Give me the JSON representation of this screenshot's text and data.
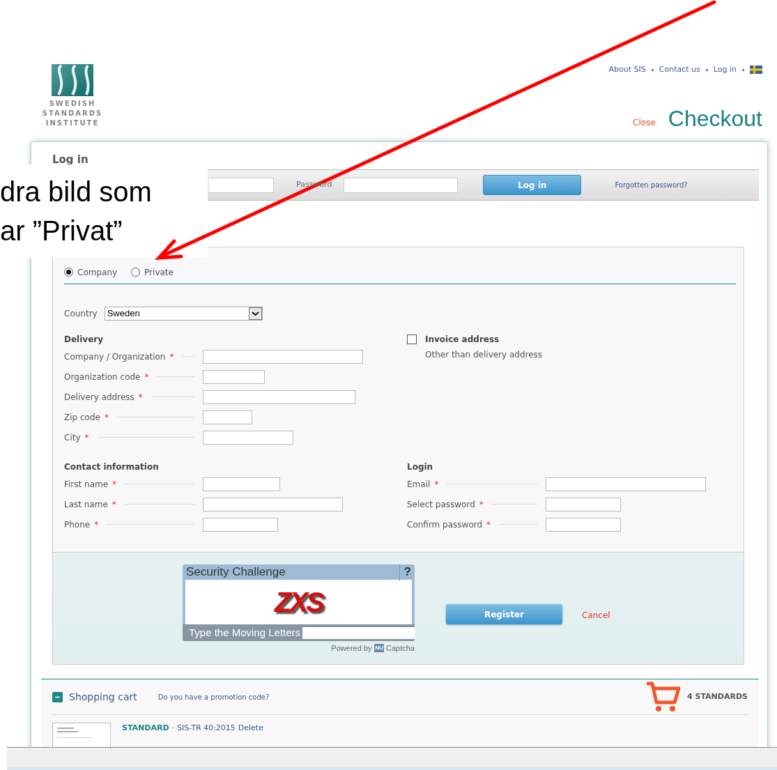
{
  "top_links": [
    "About SIS",
    "Contact us",
    "Log in"
  ],
  "logo": {
    "lines": [
      "SWEDISH",
      "STANDARDS",
      "INSTITUTE"
    ]
  },
  "close": "Close",
  "title": "Checkout",
  "login": {
    "heading": "Log in",
    "password_label": "Password",
    "button": "Log in",
    "forgot": "Forgotten password?"
  },
  "annotation": {
    "lines": [
      "dra bild som",
      "ar ”Privat”"
    ]
  },
  "customer_types": [
    {
      "label": "Company",
      "selected": true
    },
    {
      "label": "Private",
      "selected": false
    }
  ],
  "country": {
    "label": "Country",
    "value": "Sweden"
  },
  "required_mark": "*",
  "delivery": {
    "heading": "Delivery",
    "fields": [
      {
        "label": "Company / Organization",
        "required": true
      },
      {
        "label": "Organization code",
        "required": true
      },
      {
        "label": "Delivery address",
        "required": true
      },
      {
        "label": "Zip code",
        "required": true
      },
      {
        "label": "City",
        "required": true
      }
    ]
  },
  "invoice": {
    "label": "Invoice address",
    "checked": false,
    "note": "Other than delivery address"
  },
  "contact": {
    "heading": "Contact information",
    "fields": [
      {
        "label": "First name",
        "required": true
      },
      {
        "label": "Last name",
        "required": true
      },
      {
        "label": "Phone",
        "required": true
      }
    ]
  },
  "account": {
    "heading": "Login",
    "fields": [
      {
        "label": "Email",
        "required": true
      },
      {
        "label": "Select password",
        "required": true
      },
      {
        "label": "Confirm password",
        "required": true
      }
    ]
  },
  "captcha": {
    "title": "Security Challenge",
    "help": "?",
    "letters": "ZXS",
    "prompt": "Type the Moving Letters",
    "powered_by": "Powered by",
    "badge": "NU",
    "brand": "Captcha"
  },
  "register": "Register",
  "cancel": "Cancel",
  "cart": {
    "title": "Shopping cart",
    "expanded": true,
    "promo": "Do you have a promotion code?",
    "count": "4 STANDARDS",
    "items": [
      {
        "type": "STANDARD",
        "separator": "·",
        "code": "SIS-TR 40:2015",
        "action": "Delete"
      }
    ]
  }
}
